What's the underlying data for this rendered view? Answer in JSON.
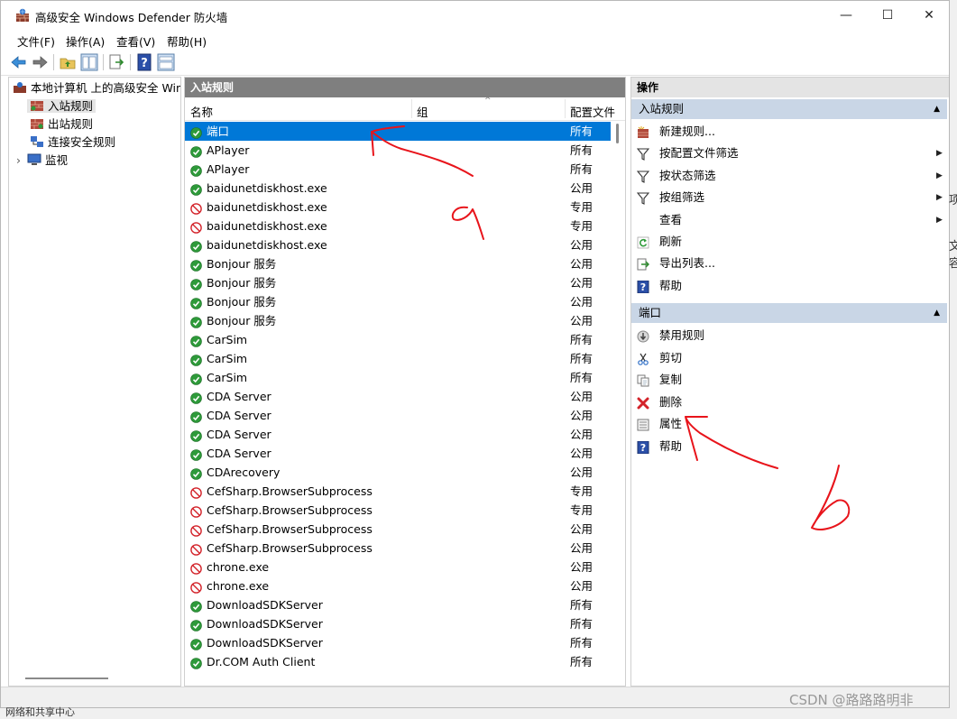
{
  "window": {
    "title": "高级安全 Windows Defender 防火墙",
    "minimize_glyph": "—",
    "maximize_glyph": "☐",
    "close_glyph": "✕"
  },
  "menu": [
    "文件(F)",
    "操作(A)",
    "查看(V)",
    "帮助(H)"
  ],
  "tree": {
    "root": "本地计算机 上的高级安全 Windows",
    "items": [
      "入站规则",
      "出站规则",
      "连接安全规则",
      "监视"
    ],
    "selected": "入站规则"
  },
  "list": {
    "header": "入站规则",
    "columns": {
      "name": "名称",
      "group": "组",
      "profile": "配置文件"
    },
    "rows": [
      {
        "name": "端口",
        "profile": "所有",
        "icon": "allow-icon",
        "selected": true
      },
      {
        "name": "APlayer",
        "profile": "所有",
        "icon": "allow-icon"
      },
      {
        "name": "APlayer",
        "profile": "所有",
        "icon": "allow-icon"
      },
      {
        "name": "baidunetdiskhost.exe",
        "profile": "公用",
        "icon": "allow-icon"
      },
      {
        "name": "baidunetdiskhost.exe",
        "profile": "专用",
        "icon": "block-icon"
      },
      {
        "name": "baidunetdiskhost.exe",
        "profile": "专用",
        "icon": "block-icon"
      },
      {
        "name": "baidunetdiskhost.exe",
        "profile": "公用",
        "icon": "allow-icon"
      },
      {
        "name": "Bonjour 服务",
        "profile": "公用",
        "icon": "allow-icon"
      },
      {
        "name": "Bonjour 服务",
        "profile": "公用",
        "icon": "allow-icon"
      },
      {
        "name": "Bonjour 服务",
        "profile": "公用",
        "icon": "allow-icon"
      },
      {
        "name": "Bonjour 服务",
        "profile": "公用",
        "icon": "allow-icon"
      },
      {
        "name": "CarSim",
        "profile": "所有",
        "icon": "allow-icon"
      },
      {
        "name": "CarSim",
        "profile": "所有",
        "icon": "allow-icon"
      },
      {
        "name": "CarSim",
        "profile": "所有",
        "icon": "allow-icon"
      },
      {
        "name": "CDA Server",
        "profile": "公用",
        "icon": "allow-icon"
      },
      {
        "name": "CDA Server",
        "profile": "公用",
        "icon": "allow-icon"
      },
      {
        "name": "CDA Server",
        "profile": "公用",
        "icon": "allow-icon"
      },
      {
        "name": "CDA Server",
        "profile": "公用",
        "icon": "allow-icon"
      },
      {
        "name": "CDArecovery",
        "profile": "公用",
        "icon": "allow-icon"
      },
      {
        "name": "CefSharp.BrowserSubprocess",
        "profile": "专用",
        "icon": "block-icon"
      },
      {
        "name": "CefSharp.BrowserSubprocess",
        "profile": "专用",
        "icon": "block-icon"
      },
      {
        "name": "CefSharp.BrowserSubprocess",
        "profile": "公用",
        "icon": "block-icon"
      },
      {
        "name": "CefSharp.BrowserSubprocess",
        "profile": "公用",
        "icon": "block-icon"
      },
      {
        "name": "chrone.exe",
        "profile": "公用",
        "icon": "block-icon"
      },
      {
        "name": "chrone.exe",
        "profile": "公用",
        "icon": "block-icon"
      },
      {
        "name": "DownloadSDKServer",
        "profile": "所有",
        "icon": "allow-icon"
      },
      {
        "name": "DownloadSDKServer",
        "profile": "所有",
        "icon": "allow-icon"
      },
      {
        "name": "DownloadSDKServer",
        "profile": "所有",
        "icon": "allow-icon"
      },
      {
        "name": "Dr.COM Auth Client",
        "profile": "所有",
        "icon": "allow-icon"
      }
    ]
  },
  "actions": {
    "title": "操作",
    "section1": {
      "label": "入站规则",
      "items": [
        {
          "label": "新建规则...",
          "icon": "new-rule-icon"
        },
        {
          "label": "按配置文件筛选",
          "icon": "filter-icon",
          "submenu": true
        },
        {
          "label": "按状态筛选",
          "icon": "filter-icon",
          "submenu": true
        },
        {
          "label": "按组筛选",
          "icon": "filter-icon",
          "submenu": true
        },
        {
          "label": "查看",
          "icon": "",
          "submenu": true
        },
        {
          "label": "刷新",
          "icon": "refresh-icon"
        },
        {
          "label": "导出列表...",
          "icon": "export-icon"
        },
        {
          "label": "帮助",
          "icon": "help-icon"
        }
      ]
    },
    "section2": {
      "label": "端口",
      "items": [
        {
          "label": "禁用规则",
          "icon": "disable-icon"
        },
        {
          "label": "剪切",
          "icon": "cut-icon"
        },
        {
          "label": "复制",
          "icon": "copy-icon"
        },
        {
          "label": "删除",
          "icon": "delete-icon"
        },
        {
          "label": "属性",
          "icon": "properties-icon"
        },
        {
          "label": "帮助",
          "icon": "help-icon"
        }
      ]
    }
  },
  "footer": {
    "watermark": "CSDN @路路路明非",
    "below_text": "网络和共享中心"
  },
  "right_strip": [
    "项",
    "文",
    "容"
  ],
  "colors": {
    "selection": "#0078d7",
    "list_header": "#7f7f7f",
    "section": "#c9d6e6",
    "annotation": "#e8141b"
  }
}
